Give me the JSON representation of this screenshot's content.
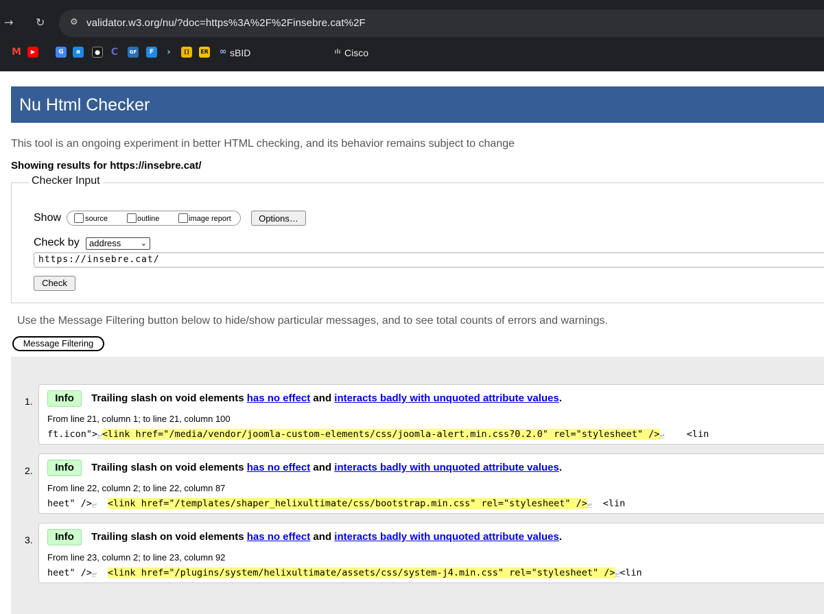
{
  "browser": {
    "url": "validator.w3.org/nu/?doc=https%3A%2F%2Finsebre.cat%2F",
    "bookmarks": [
      {
        "icon": "gmail-icon",
        "label": "",
        "color": "#ea4335",
        "glyph": "M"
      },
      {
        "icon": "youtube-icon",
        "label": "",
        "color": "#ff0000",
        "glyph": "▶"
      },
      {
        "icon": "translate-icon",
        "label": "",
        "color": "#4285f4",
        "glyph": "G"
      },
      {
        "icon": "app-icon",
        "label": "",
        "color": "#1e88e5",
        "glyph": "a"
      },
      {
        "icon": "chatgpt-icon",
        "label": "",
        "color": "#1a1a1a",
        "glyph": "●"
      },
      {
        "icon": "moon-icon",
        "label": "",
        "color": "#3f51b5",
        "glyph": "C"
      },
      {
        "icon": "gf-icon",
        "label": "",
        "color": "#2a6fb5",
        "glyph": "GF"
      },
      {
        "icon": "forms-icon",
        "label": "",
        "color": "#1e88e5",
        "glyph": "F"
      },
      {
        "icon": "arrow-icon",
        "label": "",
        "color": "#202124",
        "glyph": "›"
      },
      {
        "icon": "notes-icon",
        "label": "",
        "color": "#f4b400",
        "glyph": "[]"
      },
      {
        "icon": "er-icon",
        "label": "",
        "color": "#f2c200",
        "glyph": "ER"
      },
      {
        "icon": "sbid-icon",
        "label": "sBID",
        "color": "#4a90e2",
        "glyph": "∞"
      },
      {
        "icon": "cisco-icon",
        "label": "Cisco",
        "color": "#202124",
        "glyph": "ılı"
      }
    ]
  },
  "page": {
    "title": "Nu Html Checker",
    "intro": "This tool is an ongoing experiment in better HTML checking, and its behavior remains subject to change",
    "showing_prefix": "Showing results for ",
    "showing_url": "https://insebre.cat/"
  },
  "checker": {
    "legend": "Checker Input",
    "show_label": "Show",
    "options": [
      {
        "label": "source",
        "checked": false
      },
      {
        "label": "outline",
        "checked": false
      },
      {
        "label": "image report",
        "checked": false
      }
    ],
    "options_button": "Options…",
    "check_by_label": "Check by",
    "check_by_value": "address",
    "url_value": "https://insebre.cat/",
    "check_button": "Check"
  },
  "filtering": {
    "note": "Use the Message Filtering button below to hide/show particular messages, and to see total counts of errors and warnings.",
    "button": "Message Filtering"
  },
  "messages": [
    {
      "num": "1.",
      "type": "Info",
      "title_start": "Trailing slash on void elements ",
      "link1": "has no effect",
      "title_mid": " and ",
      "link2": "interacts badly with unquoted attribute values",
      "title_end": ".",
      "location": "From line 21, column 1; to line 21, column 100",
      "code_pre": "ft.icon\">",
      "code_hl": "<link href=\"/media/vendor/joomla-custom-elements/css/joomla-alert.min.css?0.2.0\" rel=\"stylesheet\" />",
      "code_post": "    <lin"
    },
    {
      "num": "2.",
      "type": "Info",
      "title_start": "Trailing slash on void elements ",
      "link1": "has no effect",
      "title_mid": " and ",
      "link2": "interacts badly with unquoted attribute values",
      "title_end": ".",
      "location": "From line 22, column 2; to line 22, column 87",
      "code_pre": "heet\" />",
      "code_hl": "<link href=\"/templates/shaper_helixultimate/css/bootstrap.min.css\" rel=\"stylesheet\" />",
      "code_post": "  <lin"
    },
    {
      "num": "3.",
      "type": "Info",
      "title_start": "Trailing slash on void elements ",
      "link1": "has no effect",
      "title_mid": " and ",
      "link2": "interacts badly with unquoted attribute values",
      "title_end": ".",
      "location": "From line 23, column 2; to line 23, column 92",
      "code_pre": "heet\" />",
      "code_hl": "<link href=\"/plugins/system/helixultimate/assets/css/system-j4.min.css\" rel=\"stylesheet\" />",
      "code_post": "<lin"
    }
  ]
}
